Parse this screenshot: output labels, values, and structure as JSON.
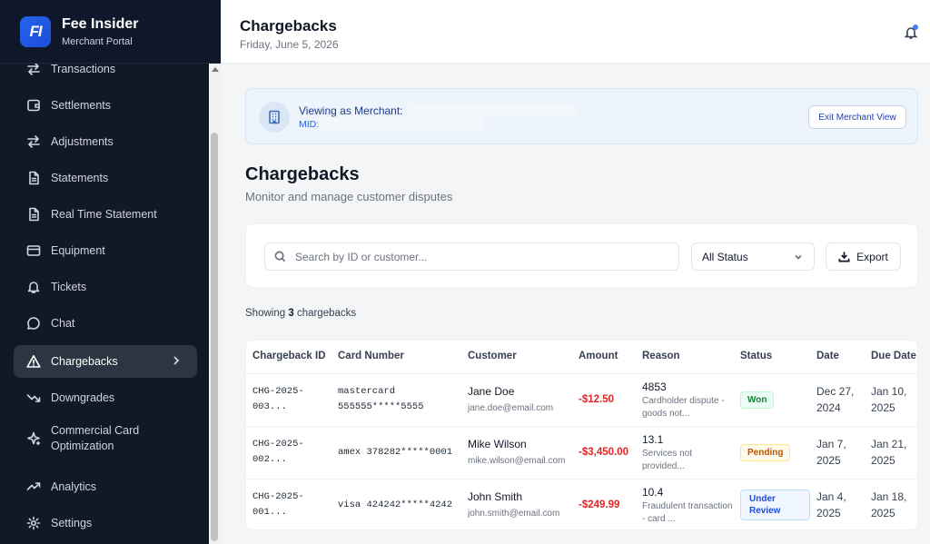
{
  "app": {
    "brand_logo": "FI",
    "brand_name": "Fee Insider",
    "brand_sub": "Merchant Portal"
  },
  "sidebar": {
    "items": [
      {
        "label": "Transactions",
        "icon": "arrows-icon"
      },
      {
        "label": "Settlements",
        "icon": "wallet-icon"
      },
      {
        "label": "Adjustments",
        "icon": "arrows-icon"
      },
      {
        "label": "Statements",
        "icon": "document-icon"
      },
      {
        "label": "Real Time Statement",
        "icon": "document-icon"
      },
      {
        "label": "Equipment",
        "icon": "card-icon"
      },
      {
        "label": "Tickets",
        "icon": "bell-icon"
      },
      {
        "label": "Chat",
        "icon": "chat-icon"
      },
      {
        "label": "Chargebacks",
        "icon": "warning-icon",
        "active": true
      },
      {
        "label": "Downgrades",
        "icon": "trend-down-icon"
      },
      {
        "label": "Commercial Card Optimization",
        "icon": "sparkle-icon"
      },
      {
        "label": "Analytics",
        "icon": "trend-up-icon"
      },
      {
        "label": "Settings",
        "icon": "gear-icon"
      }
    ]
  },
  "header": {
    "title": "Chargebacks",
    "date": "Friday, June 5, 2026"
  },
  "banner": {
    "viewing_label": "Viewing as Merchant:",
    "mid_label": "MID:",
    "exit_label": "Exit Merchant View"
  },
  "page": {
    "heading": "Chargebacks",
    "subtitle": "Monitor and manage customer disputes"
  },
  "filters": {
    "search_placeholder": "Search by ID or customer...",
    "status_value": "All Status",
    "export_label": "Export"
  },
  "summary": {
    "prefix": "Showing",
    "count": "3",
    "suffix": "chargebacks"
  },
  "table": {
    "headers": [
      "Chargeback ID",
      "Card Number",
      "Customer",
      "Amount",
      "Reason",
      "Status",
      "Date",
      "Due Date"
    ],
    "rows": [
      {
        "id": "CHG-2025-003...",
        "card": "mastercard 555555*****5555",
        "customer_name": "Jane Doe",
        "customer_email": "jane.doe@email.com",
        "amount": "-$12.50",
        "reason_code": "4853",
        "reason_desc": "Cardholder dispute - goods not...",
        "status": "Won",
        "date": "Dec 27, 2024",
        "due_date": "Jan 10, 2025"
      },
      {
        "id": "CHG-2025-002...",
        "card": "amex 378282*****0001",
        "customer_name": "Mike Wilson",
        "customer_email": "mike.wilson@email.com",
        "amount": "-$3,450.00",
        "reason_code": "13.1",
        "reason_desc": "Services not provided...",
        "status": "Pending",
        "date": "Jan 7, 2025",
        "due_date": "Jan 21, 2025"
      },
      {
        "id": "CHG-2025-001...",
        "card": "visa 424242*****4242",
        "customer_name": "John Smith",
        "customer_email": "john.smith@email.com",
        "amount": "-$249.99",
        "reason_code": "10.4",
        "reason_desc": "Fraudulent transaction - card ...",
        "status": "Under Review",
        "date": "Jan 4, 2025",
        "due_date": "Jan 18, 2025"
      }
    ]
  },
  "colors": {
    "sidebar_bg": "#111827",
    "accent": "#2563eb",
    "amount_negative": "#dc2626",
    "status_won": "#15803d",
    "status_pending": "#b45309",
    "status_review": "#1d4ed8"
  }
}
